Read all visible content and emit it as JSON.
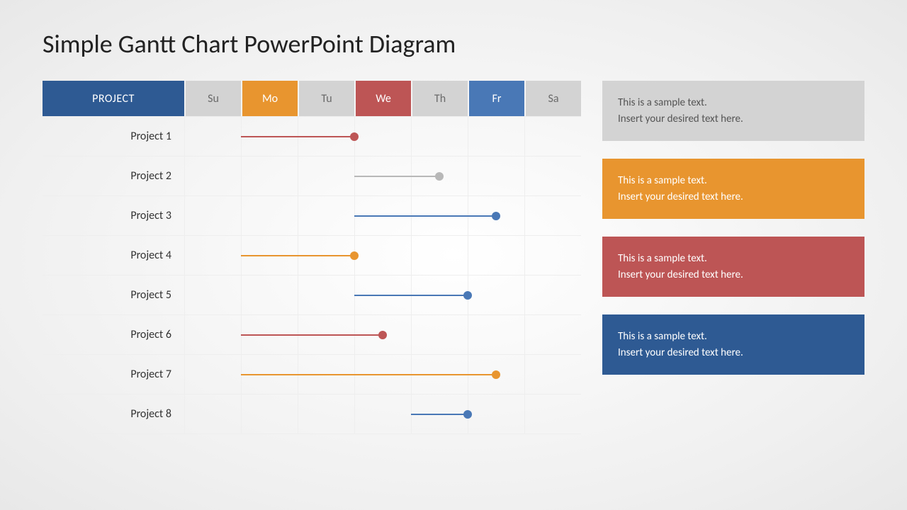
{
  "title": "Simple Gantt Chart PowerPoint Diagram",
  "header": {
    "project": "PROJECT",
    "days": [
      "Su",
      "Mo",
      "Tu",
      "We",
      "Th",
      "Fr",
      "Sa"
    ]
  },
  "colors": {
    "red": "#bd5555",
    "gray": "#b8b8b8",
    "blue": "#4978b6",
    "orange": "#e8952f",
    "navy": "#2e5a93",
    "lightgray": "#d3d3d3"
  },
  "chart_data": {
    "type": "bar",
    "title": "Simple Gantt Chart PowerPoint Diagram",
    "xlabel": "",
    "ylabel": "",
    "categories": [
      "Su",
      "Mo",
      "Tu",
      "We",
      "Th",
      "Fr",
      "Sa"
    ],
    "series": [
      {
        "name": "Project 1",
        "start": 1,
        "end": 3,
        "color": "red"
      },
      {
        "name": "Project 2",
        "start": 3,
        "end": 4.5,
        "color": "gray"
      },
      {
        "name": "Project 3",
        "start": 3,
        "end": 5.5,
        "color": "blue"
      },
      {
        "name": "Project 4",
        "start": 1,
        "end": 3,
        "color": "orange"
      },
      {
        "name": "Project 5",
        "start": 3,
        "end": 5,
        "color": "blue"
      },
      {
        "name": "Project 6",
        "start": 1,
        "end": 3.5,
        "color": "red"
      },
      {
        "name": "Project 7",
        "start": 1,
        "end": 5.5,
        "color": "orange"
      },
      {
        "name": "Project 8",
        "start": 4,
        "end": 5,
        "color": "blue"
      }
    ]
  },
  "legend": [
    {
      "line1": "This is a sample text.",
      "line2": "Insert your desired text here.",
      "color": "gray"
    },
    {
      "line1": "This is a sample text.",
      "line2": "Insert your desired text here.",
      "color": "orange"
    },
    {
      "line1": "This is a sample text.",
      "line2": "Insert your desired text here.",
      "color": "red"
    },
    {
      "line1": "This is a sample text.",
      "line2": "Insert your desired text here.",
      "color": "blue"
    }
  ]
}
